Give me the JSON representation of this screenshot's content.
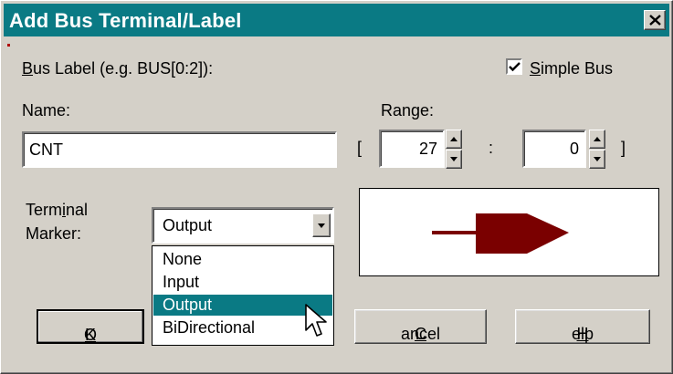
{
  "window": {
    "title": "Add Bus Terminal/Label"
  },
  "bus_label": {
    "prefix": "B",
    "rest": "us Label (e.g. BUS[0:2]):"
  },
  "simple_bus": {
    "checked": true,
    "prefix": "S",
    "rest": "imple Bus"
  },
  "name": {
    "label": "Name:",
    "value": "CNT"
  },
  "range": {
    "label": "Range:",
    "open_bracket": "[",
    "separator": ":",
    "close_bracket": "]",
    "start": "27",
    "end": "0"
  },
  "terminal_marker": {
    "label_line1_a": "Term",
    "label_line1_u": "i",
    "label_line1_b": "nal",
    "label_line2": "Marker:",
    "selected": "Output",
    "options": [
      "None",
      "Input",
      "Output",
      "BiDirectional"
    ],
    "highlighted_index": 2
  },
  "buttons": {
    "ok": {
      "a": "O",
      "u": "K"
    },
    "cancel": {
      "u": "C",
      "rest": "ancel"
    },
    "help": {
      "u": "H",
      "rest": "elp"
    }
  },
  "colors": {
    "title_bar": "#0a7a84",
    "marker_arrow": "#7a0000",
    "highlight": "#0a7a84"
  },
  "icons": {
    "close": "close-icon",
    "check": "checkmark-icon",
    "spin_up": "arrow-up-icon",
    "spin_down": "arrow-down-icon",
    "combo": "chevron-down-icon",
    "cursor": "mouse-pointer-icon"
  }
}
